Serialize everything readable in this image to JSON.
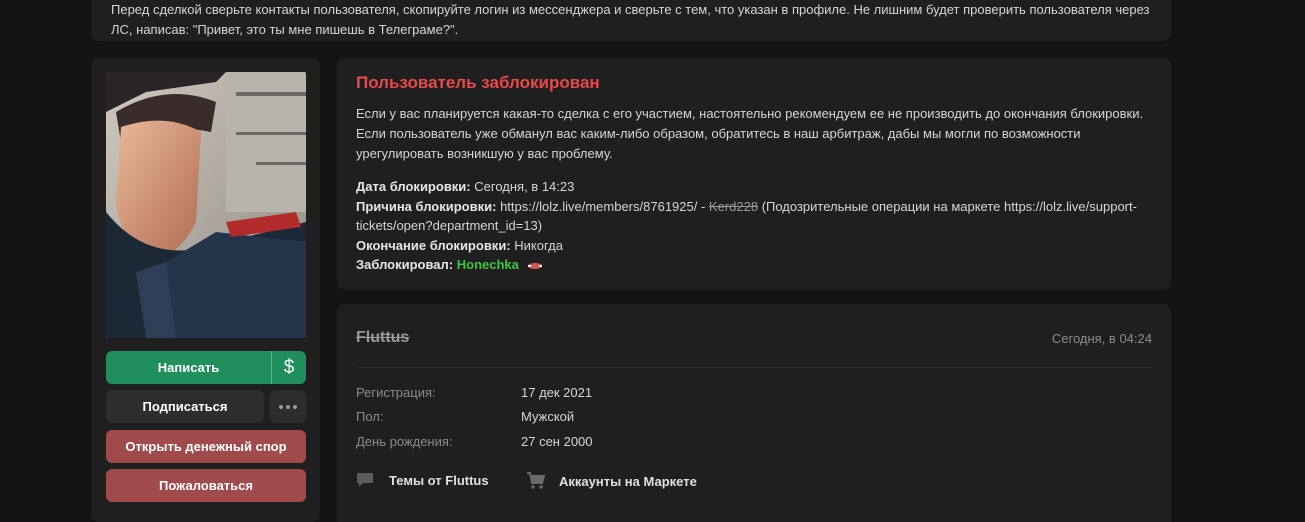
{
  "notice": {
    "text": "Перед сделкой сверьте контакты пользователя, скопируйте логин из мессенджера и сверьте с тем, что указан в профиле. Не лишним будет проверить пользователя через ЛС, написав: \"Привет, это ты мне пишешь в Телеграме?\"."
  },
  "sidebar": {
    "write_label": "Написать",
    "money_label": "$",
    "subscribe_label": "Подписаться",
    "more_label": "•••",
    "dispute_label": "Открыть денежный спор",
    "report_label": "Пожаловаться"
  },
  "ban": {
    "title": "Пользователь заблокирован",
    "text": "Если у вас планируется какая-то сделка с его участием, настоятельно рекомендуем ее не производить до окончания блокировки. Если пользователь уже обманул вас каким-либо образом, обратитесь в наш арбитраж, дабы мы могли по возможности урегулировать возникшую у вас проблему.",
    "date_label": "Дата блокировки:",
    "date_value": "Сегодня, в 14:23",
    "reason_label": "Причина блокировки:",
    "reason_link": "https://lolz.live/members/8761925/",
    "reason_sep": " - ",
    "reason_user": "Kerd228",
    "reason_text": " (Подозрительные операции на маркете https://lolz.live/support-tickets/open?department_id=13)",
    "end_label": "Окончание блокировки:",
    "end_value": "Никогда",
    "banned_by_label": "Заблокировал:",
    "banned_by_value": "Honechka"
  },
  "profile": {
    "username": "Fluttus",
    "last_seen": "Сегодня, в 04:24",
    "fields": [
      {
        "label": "Регистрация:",
        "value": "17 дек 2021"
      },
      {
        "label": "Пол:",
        "value": "Мужской"
      },
      {
        "label": "День рождения:",
        "value": "27 сен 2000"
      }
    ],
    "threads_label": "Темы от Fluttus",
    "market_label": "Аккаунты на Маркете"
  },
  "colors": {
    "accent_green": "#218e5d",
    "danger": "#e84a4a",
    "danger_button": "#a04a4c",
    "moderator_green": "#3fc53f"
  }
}
